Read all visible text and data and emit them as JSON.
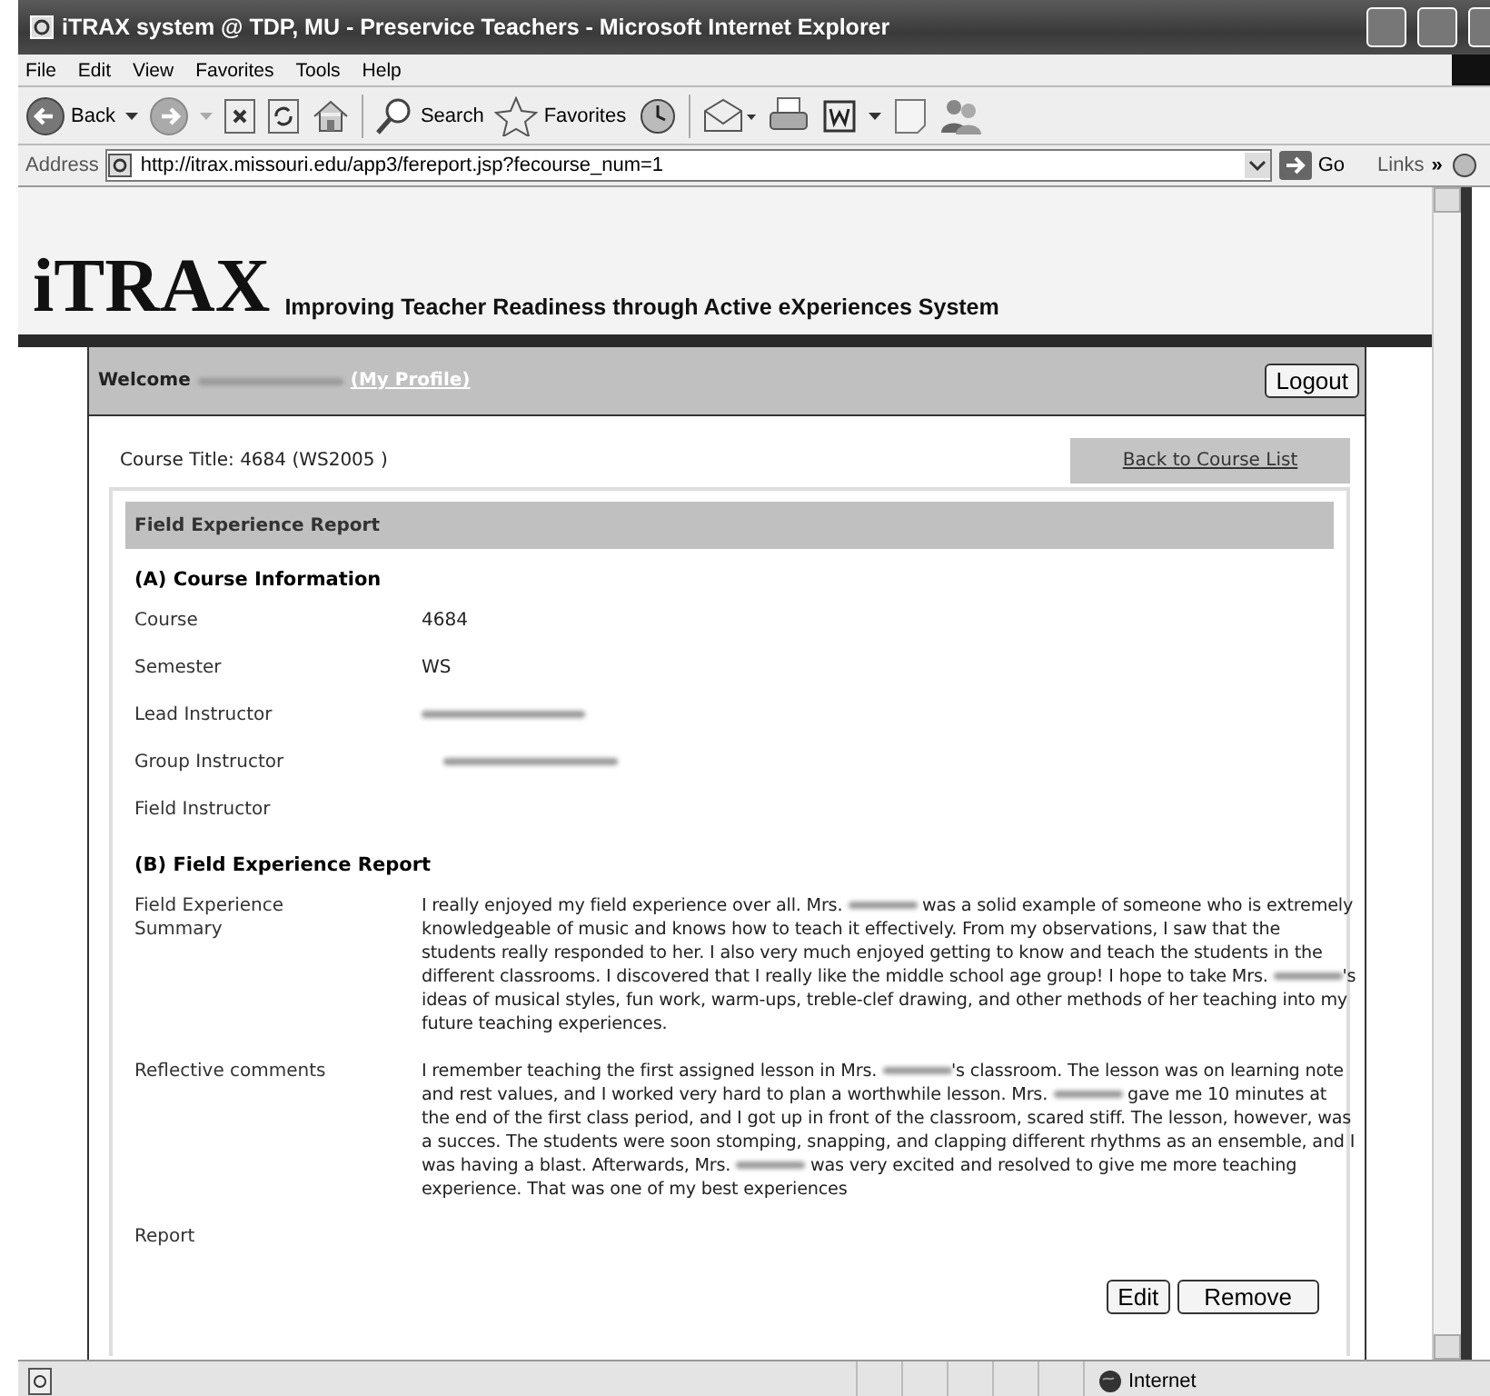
{
  "window": {
    "title": "iTRAX system @ TDP, MU - Preservice Teachers - Microsoft Internet Explorer"
  },
  "menu": [
    "File",
    "Edit",
    "View",
    "Favorites",
    "Tools",
    "Help"
  ],
  "toolbar": {
    "back": "Back",
    "search": "Search",
    "favorites": "Favorites"
  },
  "address": {
    "label": "Address",
    "url": "http://itrax.missouri.edu/app3/fereport.jsp?fecourse_num=1",
    "go": "Go",
    "links": "Links",
    "chevron": "»"
  },
  "site": {
    "logo": "iTRAX",
    "tagline": "Improving Teacher Readiness through Active eXperiences System"
  },
  "welcome": {
    "label": "Welcome",
    "name_redacted": true,
    "profile_link": "(My Profile)",
    "logout": "Logout"
  },
  "course_title": "Course Title: 4684 (WS2005 )",
  "back_link": "Back to Course List",
  "report": {
    "title": "Field Experience Report",
    "sections": [
      {
        "heading": "(A) Course Information",
        "rows": [
          {
            "label": "Course",
            "value": "4684"
          },
          {
            "label": "Semester",
            "value": "WS"
          },
          {
            "label": "Lead Instructor",
            "redacted": true
          },
          {
            "label": "Group Instructor",
            "redacted": true
          },
          {
            "label": "Field Instructor"
          }
        ]
      },
      {
        "heading": "(B) Field Experience Report",
        "rows": [
          {
            "label": "Field Experience Summary",
            "text_parts": [
              "I really enjoyed my field experience over all. Mrs. ",
              " was a solid example of someone who is extremely knowledgeable of music and knows how to teach it effectively. From my observations, I saw that the students really responded to her. I also very much enjoyed getting to know and teach the students in the different classrooms. I discovered that I really like the middle school age group! I hope to take Mrs. ",
              "'s ideas of musical styles, fun work, warm-ups, treble-clef drawing, and other methods of her teaching into my future teaching experiences."
            ]
          },
          {
            "label": "Reflective comments",
            "text_parts": [
              "I remember teaching the first assigned lesson in Mrs. ",
              "'s classroom. The lesson was on learning note and rest values, and I worked very hard to plan a worthwhile lesson. Mrs. ",
              " gave me 10 minutes at the end of the first class period, and I got up in front of the classroom, scared stiff. The lesson, however, was a succes. The students were soon stomping, snapping, and clapping different rhythms as an ensemble, and I was having a blast. Afterwards, Mrs. ",
              " was very excited and resolved to give me more teaching experience. That was one of my best experiences"
            ]
          },
          {
            "label": "Report"
          }
        ]
      }
    ],
    "buttons": [
      "Edit",
      "Remove"
    ]
  },
  "status_bar": {
    "zone": "Internet"
  }
}
